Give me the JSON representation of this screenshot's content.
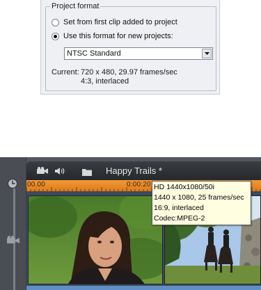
{
  "project_format": {
    "legend": "Project format",
    "radio_first_clip": {
      "label": "Set from first clip added to project",
      "checked": false
    },
    "radio_use_format": {
      "label": "Use this format for new projects:",
      "checked": true
    },
    "format_select": {
      "value": "NTSC Standard"
    },
    "current_label": "Current:",
    "current_line1": "720 x 480, 29.97 frames/sec",
    "current_line2": "4:3, interlaced"
  },
  "timeline": {
    "toolbar": {
      "icons": [
        "camera-icon",
        "speaker-icon",
        "folder-icon"
      ],
      "project_title": "Happy Trails *"
    },
    "ruler": {
      "tc_start": "00.00",
      "tc_mid": "0:00:20"
    },
    "clips": [
      {
        "name": "clip-woman-portrait"
      },
      {
        "name": "clip-riders-on-horses"
      }
    ],
    "tooltip": {
      "line1": "HD 1440x1080/50i",
      "line2": "1440 x 1080, 25 frames/sec",
      "line3": "16:9, interlaced",
      "line4": "Codec:MPEG-2"
    },
    "colors": {
      "ruler_orange": "#e8891f",
      "tooltip_bg": "#fffee1",
      "track_blue": "#5f8fc4"
    }
  }
}
